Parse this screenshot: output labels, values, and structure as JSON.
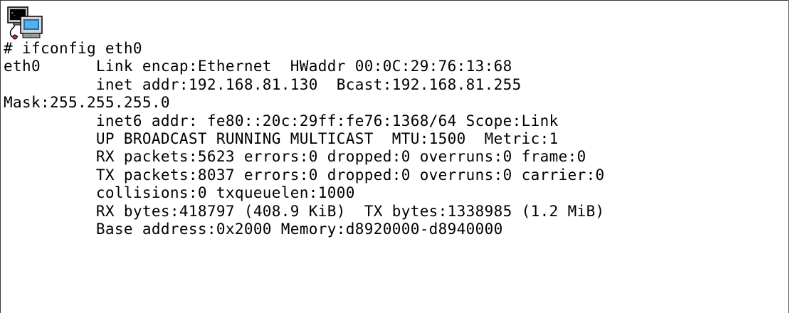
{
  "icon": {
    "name": "terminal-computer-icon"
  },
  "terminal": {
    "prompt_line": "# ifconfig eth0",
    "lines": [
      "eth0      Link encap:Ethernet  HWaddr 00:0C:29:76:13:68",
      "          inet addr:192.168.81.130  Bcast:192.168.81.255",
      "Mask:255.255.255.0",
      "          inet6 addr: fe80::20c:29ff:fe76:1368/64 Scope:Link",
      "          UP BROADCAST RUNNING MULTICAST  MTU:1500  Metric:1",
      "          RX packets:5623 errors:0 dropped:0 overruns:0 frame:0",
      "          TX packets:8037 errors:0 dropped:0 overruns:0 carrier:0",
      "          collisions:0 txqueuelen:1000",
      "          RX bytes:418797 (408.9 KiB)  TX bytes:1338985 (1.2 MiB)",
      "          Base address:0x2000 Memory:d8920000-d8940000"
    ]
  }
}
